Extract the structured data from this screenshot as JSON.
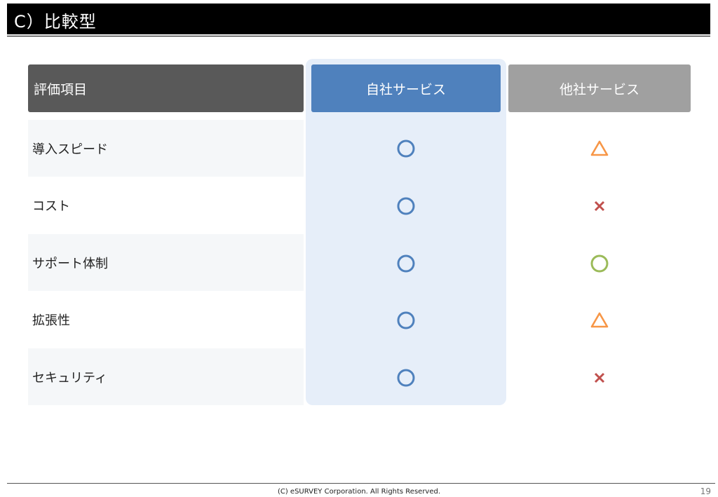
{
  "title": "C）比較型",
  "headers": {
    "item": "評価項目",
    "own": "自社サービス",
    "other": "他社サービス"
  },
  "rows": [
    {
      "label": "導入スピード",
      "own": "circle",
      "other": "triangle"
    },
    {
      "label": "コスト",
      "own": "circle",
      "other": "cross"
    },
    {
      "label": "サポート体制",
      "own": "circle",
      "other": "circle"
    },
    {
      "label": "拡張性",
      "own": "circle",
      "other": "triangle"
    },
    {
      "label": "セキュリティ",
      "own": "circle",
      "other": "cross"
    }
  ],
  "colors": {
    "own_circle": "#4f81bd",
    "other_circle": "#9bbb59",
    "triangle": "#f79646",
    "cross": "#c0504d"
  },
  "footer": {
    "copyright": "(C) eSURVEY Corporation. All Rights Reserved.",
    "page": "19"
  }
}
